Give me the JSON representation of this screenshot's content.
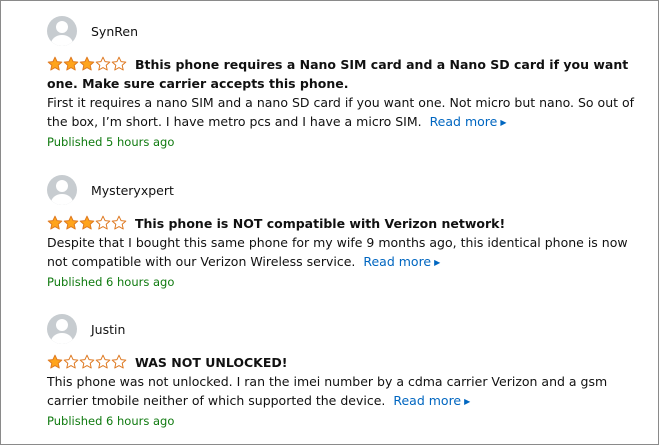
{
  "reviews": [
    {
      "author": "SynRen",
      "rating": 3,
      "max_rating": 5,
      "title": "Bthis phone requires a Nano SIM card and a Nano SD card if you want one. Make sure carrier accepts this phone.",
      "body": "First it requires a nano SIM and a nano SD card if you want one. Not micro but nano. So out of the box, I’m short. I have metro pcs and I have a micro SIM.",
      "read_more": "Read more",
      "published": "Published 5 hours ago"
    },
    {
      "author": "Mysteryxpert",
      "rating": 3,
      "max_rating": 5,
      "title": "This phone is NOT compatible with Verizon network!",
      "body": "Despite that I bought this same phone for my wife 9 months ago, this identical phone is now not compatible with our Verizon Wireless service.",
      "read_more": "Read more",
      "published": "Published 6 hours ago"
    },
    {
      "author": "Justin",
      "rating": 1,
      "max_rating": 5,
      "title": "WAS NOT UNLOCKED!",
      "body": "This phone was not unlocked. I ran the imei number by a cdma carrier Verizon and a gsm carrier tmobile neither of which supported the device.",
      "read_more": "Read more",
      "published": "Published 6 hours ago"
    }
  ],
  "colors": {
    "star_fill": "#ffa41c",
    "star_outline": "#de7921",
    "link": "#0066c0",
    "published": "#0f7a0f",
    "avatar_bg": "#c7ccd0"
  },
  "icons": {
    "avatar": "avatar-icon",
    "star_filled": "star-filled-icon",
    "star_empty": "star-empty-icon",
    "caret": "caret-right-icon"
  }
}
